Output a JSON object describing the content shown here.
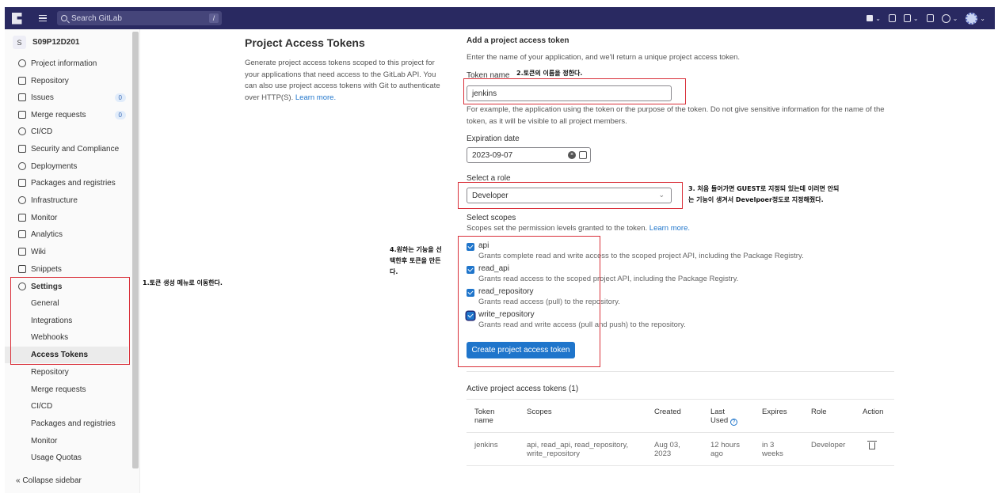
{
  "navbar": {
    "search_placeholder": "Search GitLab",
    "search_shortcut": "/",
    "chevron": "⌄"
  },
  "sidebar": {
    "project_initial": "S",
    "project_name": "S09P12D201",
    "items": [
      {
        "label": "Project information",
        "icon": "info-icon"
      },
      {
        "label": "Repository",
        "icon": "doc-icon"
      },
      {
        "label": "Issues",
        "icon": "issues-icon",
        "badge": "0"
      },
      {
        "label": "Merge requests",
        "icon": "merge-icon",
        "badge": "0"
      },
      {
        "label": "CI/CD",
        "icon": "rocket-icon"
      },
      {
        "label": "Security and Compliance",
        "icon": "shield-icon"
      },
      {
        "label": "Deployments",
        "icon": "deploy-icon"
      },
      {
        "label": "Packages and registries",
        "icon": "package-icon"
      },
      {
        "label": "Infrastructure",
        "icon": "cloud-icon"
      },
      {
        "label": "Monitor",
        "icon": "monitor-icon"
      },
      {
        "label": "Analytics",
        "icon": "chart-icon"
      },
      {
        "label": "Wiki",
        "icon": "book-icon"
      },
      {
        "label": "Snippets",
        "icon": "scissors-icon"
      },
      {
        "label": "Settings",
        "icon": "settings-icon"
      }
    ],
    "settings_sub": [
      "General",
      "Integrations",
      "Webhooks",
      "Access Tokens",
      "Repository",
      "Merge requests",
      "CI/CD",
      "Packages and registries",
      "Monitor",
      "Usage Quotas"
    ],
    "collapse_label": "Collapse sidebar"
  },
  "page": {
    "title": "Project Access Tokens",
    "description": "Generate project access tokens scoped to this project for your applications that need access to the GitLab API. You can also use project access tokens with Git to authenticate over HTTP(S).",
    "learn_more": "Learn more."
  },
  "form": {
    "heading": "Add a project access token",
    "subheading": "Enter the name of your application, and we'll return a unique project access token.",
    "token_name_label": "Token name",
    "token_name_value": "jenkins",
    "token_name_help": "For example, the application using the token or the purpose of the token. Do not give sensitive information for the name of the token, as it will be visible to all project members.",
    "expiration_label": "Expiration date",
    "expiration_value": "2023-09-07",
    "role_label": "Select a role",
    "role_value": "Developer",
    "scopes_label": "Select scopes",
    "scopes_help": "Scopes set the permission levels granted to the token.",
    "scopes_learn_more": "Learn more.",
    "scopes": [
      {
        "name": "api",
        "desc": "Grants complete read and write access to the scoped project API, including the Package Registry."
      },
      {
        "name": "read_api",
        "desc": "Grants read access to the scoped project API, including the Package Registry."
      },
      {
        "name": "read_repository",
        "desc": "Grants read access (pull) to the repository."
      },
      {
        "name": "write_repository",
        "desc": "Grants read and write access (pull and push) to the repository."
      }
    ],
    "create_button": "Create project access token"
  },
  "active_tokens": {
    "title": "Active project access tokens (1)",
    "headers": {
      "token_name_1": "Token",
      "token_name_2": "name",
      "scopes": "Scopes",
      "created": "Created",
      "last_used_1": "Last",
      "last_used_2": "Used",
      "expires": "Expires",
      "role": "Role",
      "action": "Action"
    },
    "row": {
      "name": "jenkins",
      "scopes_1": "api, read_api, read_repository,",
      "scopes_2": "write_repository",
      "created_1": "Aug 03,",
      "created_2": "2023",
      "last_used_1": "12 hours",
      "last_used_2": "ago",
      "expires_1": "in 3",
      "expires_2": "weeks",
      "role": "Developer"
    }
  },
  "annotations": {
    "a1": "1.토큰 생성 메뉴로 이동한다.",
    "a2": "2.토큰의 이름을 정한다.",
    "a3_line1": "3. 처음 들어가면 GUEST로 지정되 있는데 이러면 안되",
    "a3_line2": "는 기능이 생겨서 Develpoer정도로 지정해줬다.",
    "a4_line1": "4.원하는 기능을 선",
    "a4_line2": "택한후 토큰을 만든",
    "a4_line3": "다."
  },
  "colors": {
    "navbar": "#292961",
    "accent": "#1f75cb",
    "annotation_border": "#d9303a"
  }
}
